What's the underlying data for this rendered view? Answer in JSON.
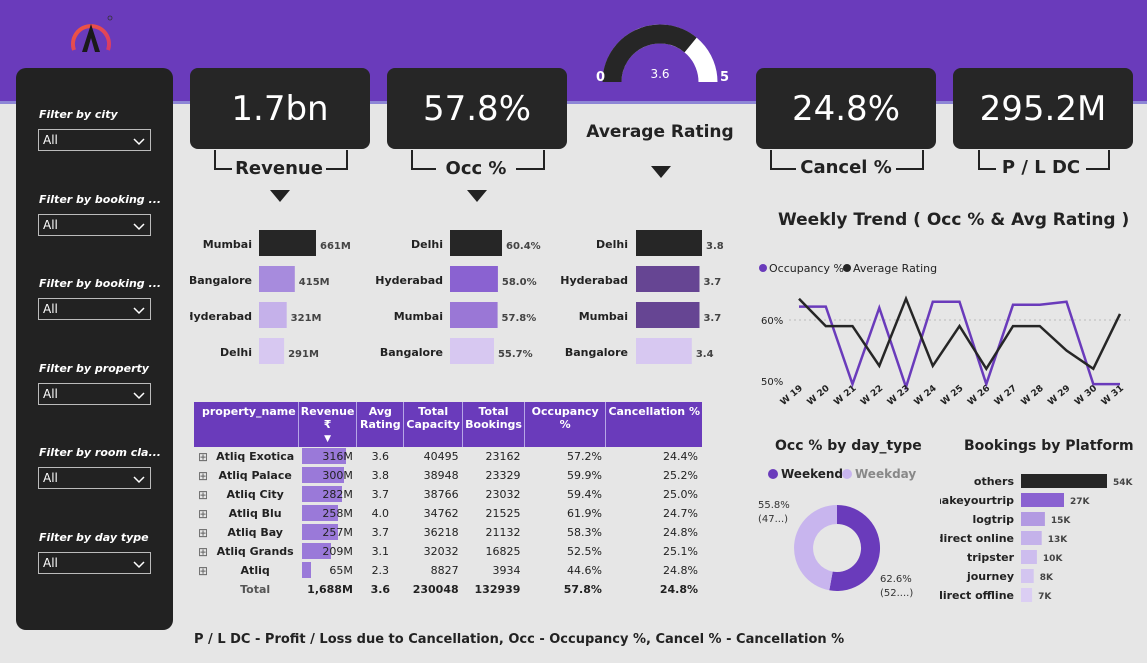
{
  "kpis": {
    "revenue": {
      "value": "1.7bn",
      "label": "Revenue"
    },
    "occ": {
      "value": "57.8%",
      "label": "Occ %"
    },
    "cancel": {
      "value": "24.8%",
      "label": "Cancel %"
    },
    "pldc": {
      "value": "295.2M",
      "label": "P / L DC"
    }
  },
  "gauge": {
    "min": "0",
    "max": "5",
    "value": "3.6",
    "value_num": 3.6,
    "title": "Average Rating"
  },
  "filters": [
    {
      "label": "Filter by city",
      "value": "All"
    },
    {
      "label": "Filter by booking ...",
      "value": "All"
    },
    {
      "label": "Filter by booking ...",
      "value": "All"
    },
    {
      "label": "Filter by property",
      "value": "All"
    },
    {
      "label": "Filter by room cla...",
      "value": "All"
    },
    {
      "label": "Filter by day type",
      "value": "All"
    }
  ],
  "chart_data": [
    {
      "type": "bar",
      "categories": [
        "Mumbai",
        "Bangalore",
        "Hyderabad",
        "Delhi"
      ],
      "values": [
        661,
        415,
        321,
        291
      ],
      "labels": [
        "661M",
        "415M",
        "321M",
        "291M"
      ],
      "colors": [
        "#262626",
        "#a78bdd",
        "#c5b1ea",
        "#d7c8f1"
      ]
    },
    {
      "type": "bar",
      "categories": [
        "Delhi",
        "Hyderabad",
        "Mumbai",
        "Bangalore"
      ],
      "values": [
        60.4,
        58.0,
        57.8,
        55.7
      ],
      "labels": [
        "60.4%",
        "58.0%",
        "57.8%",
        "55.7%"
      ],
      "colors": [
        "#262626",
        "#8a62d1",
        "#9a77d6",
        "#d7c8f1"
      ]
    },
    {
      "type": "bar",
      "categories": [
        "Delhi",
        "Hyderabad",
        "Mumbai",
        "Bangalore"
      ],
      "values": [
        3.8,
        3.7,
        3.7,
        3.4
      ],
      "labels": [
        "3.8",
        "3.7",
        "3.7",
        "3.4"
      ],
      "colors": [
        "#262626",
        "#664593",
        "#664593",
        "#d7c8f1"
      ]
    },
    {
      "type": "line",
      "title": "Weekly Trend ( Occ % & Avg Rating )",
      "x": [
        "W 19",
        "W 20",
        "W 21",
        "W 22",
        "W 23",
        "W 24",
        "W 25",
        "W 26",
        "W 27",
        "W 28",
        "W 29",
        "W 30",
        "W 31"
      ],
      "yticks": [
        "60%",
        "50%"
      ],
      "series": [
        {
          "name": "Occupancy %",
          "color": "#6a3bbb",
          "values": [
            62.2,
            62.2,
            49.5,
            62,
            49,
            63,
            63,
            49.5,
            62.5,
            62.5,
            63,
            49.5,
            49.5
          ]
        },
        {
          "name": "Average Rating",
          "color": "#262626",
          "values": [
            63.5,
            59,
            59,
            52.5,
            63.5,
            52.5,
            59,
            52,
            59,
            59,
            55,
            52,
            61
          ]
        }
      ]
    },
    {
      "type": "pie",
      "title": "Occ % by day_type",
      "series": [
        {
          "name": "Weekend",
          "value": 62.6,
          "color": "#6a3bbb",
          "label": "62.6%",
          "sub": "(52....)"
        },
        {
          "name": "Weekday",
          "value": 55.8,
          "color": "#c8b5ee",
          "label": "55.8%",
          "sub": "(47...)"
        }
      ]
    },
    {
      "type": "bar",
      "title": "Bookings by Platform",
      "categories": [
        "others",
        "makeyourtrip",
        "logtrip",
        "direct online",
        "tripster",
        "journey",
        "direct offline"
      ],
      "values": [
        54,
        27,
        15,
        13,
        10,
        8,
        7
      ],
      "labels": [
        "54K",
        "27K",
        "15K",
        "13K",
        "10K",
        "8K",
        "7K"
      ]
    }
  ],
  "table": {
    "headers": [
      "property_name",
      "Revenue ₹",
      "Avg Rating",
      "Total Capacity",
      "Total Bookings",
      "Occupancy %",
      "Cancellation %"
    ],
    "rows": [
      {
        "name": "Atliq Exotica",
        "revenue": "316M",
        "rev_num": 316,
        "rating": "3.6",
        "capacity": "40495",
        "bookings": "23162",
        "occ": "57.2%",
        "cancel": "24.4%"
      },
      {
        "name": "Atliq Palace",
        "revenue": "300M",
        "rev_num": 300,
        "rating": "3.8",
        "capacity": "38948",
        "bookings": "23329",
        "occ": "59.9%",
        "cancel": "25.2%"
      },
      {
        "name": "Atliq City",
        "revenue": "282M",
        "rev_num": 282,
        "rating": "3.7",
        "capacity": "38766",
        "bookings": "23032",
        "occ": "59.4%",
        "cancel": "25.0%"
      },
      {
        "name": "Atliq Blu",
        "revenue": "258M",
        "rev_num": 258,
        "rating": "4.0",
        "capacity": "34762",
        "bookings": "21525",
        "occ": "61.9%",
        "cancel": "24.7%"
      },
      {
        "name": "Atliq Bay",
        "revenue": "257M",
        "rev_num": 257,
        "rating": "3.7",
        "capacity": "36218",
        "bookings": "21132",
        "occ": "58.3%",
        "cancel": "24.8%"
      },
      {
        "name": "Atliq Grands",
        "revenue": "209M",
        "rev_num": 209,
        "rating": "3.1",
        "capacity": "32032",
        "bookings": "16825",
        "occ": "52.5%",
        "cancel": "25.1%"
      },
      {
        "name": "Atliq",
        "revenue": "65M",
        "rev_num": 65,
        "rating": "2.3",
        "capacity": "8827",
        "bookings": "3934",
        "occ": "44.6%",
        "cancel": "24.8%"
      }
    ],
    "total": {
      "name": "Total",
      "revenue": "1,688M",
      "rating": "3.6",
      "capacity": "230048",
      "bookings": "132939",
      "occ": "57.8%",
      "cancel": "24.8%"
    }
  },
  "footer": "P / L DC - Profit / Loss due to Cancellation, Occ - Occupancy %, Cancel % - Cancellation %"
}
